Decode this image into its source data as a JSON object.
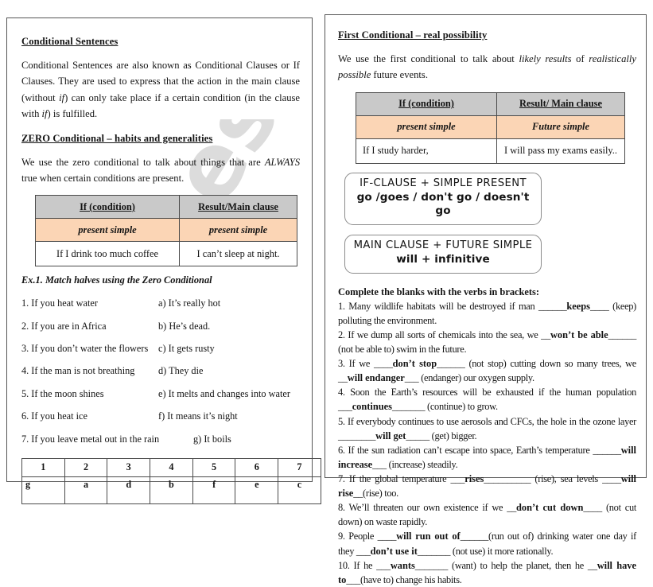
{
  "watermark": {
    "text": "eslprintables.com"
  },
  "left_panel": {
    "title": "Conditional Sentences",
    "intro_1": "Conditional Sentences are also known as Conditional Clauses or If Clauses. They are used to express that the action in the main clause (without ",
    "intro_1_it1": "if",
    "intro_1_b": ") can only take place if a certain condition (in the clause with ",
    "intro_1_it2": "if",
    "intro_1_c": ") is fulfilled.",
    "zero_title": "ZERO Conditional – habits and generalities",
    "zero_intro_a": "We use the zero conditional to talk about things that are ",
    "zero_intro_it": "ALWAYS",
    "zero_intro_b": " true when certain conditions are present.",
    "table": {
      "header": [
        " If (condition)",
        "Result/Main clause"
      ],
      "tense": [
        "present simple",
        "present simple"
      ],
      "example": [
        "If I drink too much coffee",
        "I can’t sleep at night."
      ]
    },
    "exercise_label": "Ex.1. Match halves using the Zero Conditional",
    "match_items": [
      {
        "left": "1. If you heat water",
        "right": "a) It’s really hot"
      },
      {
        "left": "2. If you are in Africa",
        "right": "b) He’s dead."
      },
      {
        "left": "3. If you don’t water the flowers",
        "right": "c) It gets rusty"
      },
      {
        "left": "4. If the man is not breathing",
        "right": "d) They die"
      },
      {
        "left": "5. If the moon shines",
        "right": "e)  It melts and changes into water"
      },
      {
        "left": "6.  If you heat ice",
        "right": "f) It means it’s night"
      },
      {
        "left": "7.  If you leave metal out in the rain",
        "right": "g)  It boils"
      }
    ],
    "answer_key": {
      "numbers": [
        "1",
        "2",
        "3",
        "4",
        "5",
        "6",
        "7"
      ],
      "answers": [
        "g",
        "a",
        "d",
        "b",
        "f",
        "e",
        "c"
      ]
    }
  },
  "right_panel": {
    "title": "First Conditional – real possibility",
    "intro_a": "We use the first conditional to talk about ",
    "intro_it1": "likely results",
    "intro_b": " of ",
    "intro_it2": "realistically possible",
    "intro_c": " future events.",
    "table": {
      "header": [
        " If (condition)",
        "Result/ Main clause"
      ],
      "tense": [
        "present simple",
        "Future simple"
      ],
      "example": [
        "If I study harder,",
        "I will pass my exams easily.."
      ]
    },
    "callouts": [
      {
        "line1": "IF-CLAUSE + SIMPLE PRESENT",
        "line2": "go /goes / don't go / doesn't go"
      },
      {
        "line1": "MAIN CLAUSE + FUTURE SIMPLE",
        "line2": "will + infinitive"
      }
    ],
    "gapfill_title": "Complete the blanks with the verbs in brackets:",
    "gapfill_items": [
      {
        "pre": "1. Many wildlife habitats will be destroyed if man ______",
        "answer": "keeps",
        "post": "____ (keep) polluting the environment."
      },
      {
        "pre": "2. If we dump all sorts of chemicals into the sea, we __",
        "answer": "won’t be able",
        "post": "______ (not be able to) swim in the future."
      },
      {
        "pre": "3.  If  we  ____",
        "answer": "don’t stop",
        "post": "______  (not stop) cutting down so many trees, we __",
        "answer2": "will endanger",
        "post2": "___ (endanger) our oxygen supply."
      },
      {
        "pre": "4.  Soon the Earth’s resources will be exhausted if the human population ___",
        "answer": "continues",
        "post": "_______ (continue) to grow."
      },
      {
        "pre": "5. If everybody continues to use aerosols and CFCs, the hole in the ozone layer ________",
        "answer": "will get",
        "post": "_____ (get) bigger."
      },
      {
        "pre": "6. If the sun radiation can’t escape into space, Earth’s temperature ______",
        "answer": "will increase",
        "post": "___ (increase) steadily."
      },
      {
        "pre": "7.  If  the  global  temperature  ___",
        "answer": "rises",
        "post": "__________  (rise), sea levels ____",
        "answer2": "will rise",
        "post2": "__(rise) too."
      },
      {
        "pre": "8. We’ll threaten our own existence if we __",
        "answer": "don’t cut down",
        "post": "____ (not cut down) on waste rapidly."
      },
      {
        "pre": "9. People ____",
        "answer": "will run out of",
        "post": "______(run out of) drinking water one day if they ___",
        "answer2": "don’t use it",
        "post2": "_______ (not use) it more rationally."
      },
      {
        "pre": "10. If he ___",
        "answer": "wants",
        "post": "_______ (want) to help the planet, then he __",
        "answer2": "will have to",
        "post2": "___(have to) change his habits."
      }
    ]
  }
}
